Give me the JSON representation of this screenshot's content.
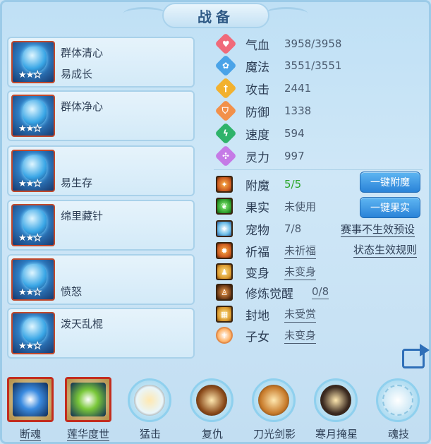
{
  "title": "战备",
  "pets": [
    {
      "line1": "群体清心",
      "line2": "易成长",
      "stars": 2,
      "max_stars": 3
    },
    {
      "line1": "群体净心",
      "line2": "",
      "stars": 2,
      "max_stars": 3
    },
    {
      "line1": "",
      "line2": "易生存",
      "stars": 2,
      "max_stars": 3
    },
    {
      "line1": "绵里藏针",
      "line2": "",
      "stars": 2,
      "max_stars": 3
    },
    {
      "line1": "",
      "line2": "愤怒",
      "stars": 2,
      "max_stars": 3
    },
    {
      "line1": "泼天乱棍",
      "line2": "",
      "stars": 2,
      "max_stars": 3
    }
  ],
  "stats": [
    {
      "label": "气血",
      "value": "3958/3958",
      "icon": "heart-icon",
      "color": "#f06a7a"
    },
    {
      "label": "魔法",
      "value": "3551/3551",
      "icon": "magic-icon",
      "color": "#4aa3e8"
    },
    {
      "label": "攻击",
      "value": "2441",
      "icon": "sword-icon",
      "color": "#f2b12f"
    },
    {
      "label": "防御",
      "value": "1338",
      "icon": "shield-icon",
      "color": "#f2904a"
    },
    {
      "label": "速度",
      "value": "594",
      "icon": "lightning-icon",
      "color": "#2fb36a"
    },
    {
      "label": "灵力",
      "value": "997",
      "icon": "spirit-icon",
      "color": "#c57ae6"
    }
  ],
  "attrs": {
    "enchant": {
      "label": "附魔",
      "value": "5/5"
    },
    "fruit": {
      "label": "果实",
      "value": "未使用"
    },
    "pet": {
      "label": "宠物",
      "value": "7/8"
    },
    "blessing": {
      "label": "祈福",
      "value": "未祈福"
    },
    "transform": {
      "label": "变身",
      "value": "未变身"
    },
    "cultivation": {
      "label": "修炼觉醒",
      "value": "0/8"
    },
    "fief": {
      "label": "封地",
      "value": "未受赏"
    },
    "children": {
      "label": "子女",
      "value": "未变身"
    }
  },
  "buttons": {
    "one_click_enchant": "一键附魔",
    "one_click_fruit": "一键果实"
  },
  "links": {
    "event_preset": "赛事不生效预设",
    "status_rules": "状态生效规则"
  },
  "skills": [
    {
      "name": "断魂",
      "style": "framed",
      "underlined": true,
      "color": "#3a8be0"
    },
    {
      "name": "莲华度世",
      "style": "framed",
      "underlined": true,
      "color": "#7ac83a"
    },
    {
      "name": "猛击",
      "style": "circle",
      "underlined": false,
      "color": "#e9f6fb"
    },
    {
      "name": "复仇",
      "style": "circle",
      "underlined": false,
      "color": "#8a4a1a"
    },
    {
      "name": "刀光剑影",
      "style": "circle",
      "underlined": false,
      "color": "#c77a2a"
    },
    {
      "name": "寒月掩星",
      "style": "circle",
      "underlined": false,
      "color": "#3b2a20"
    },
    {
      "name": "魂技",
      "style": "circle-empty",
      "underlined": false,
      "color": "#cfe9f6"
    }
  ]
}
